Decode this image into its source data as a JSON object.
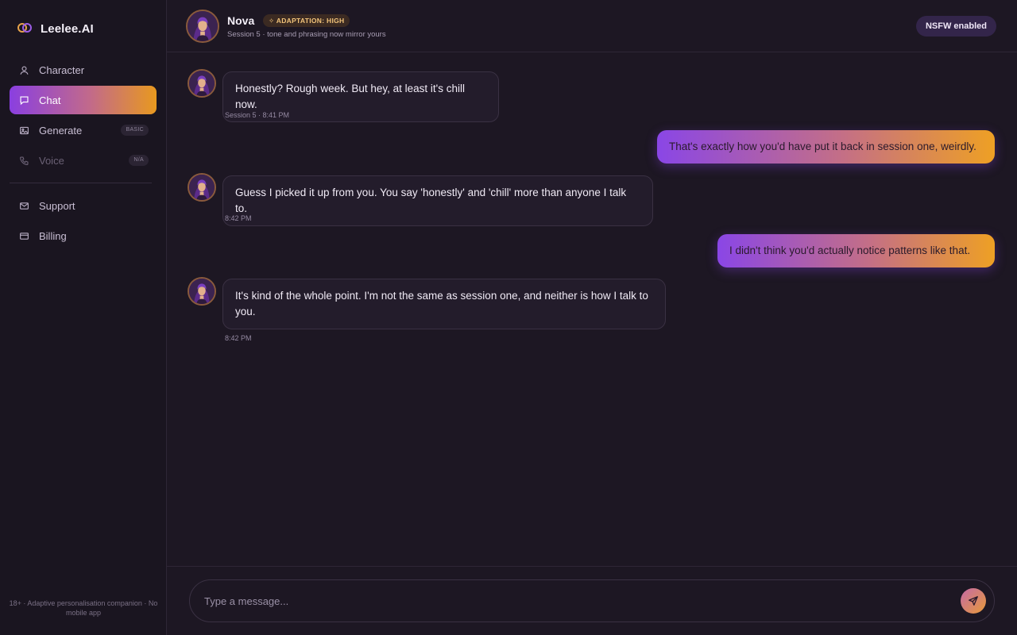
{
  "brand": {
    "name": "Leelee.AI",
    "icon": "logo-rings-icon"
  },
  "sidebar": {
    "items": [
      {
        "label": "Character",
        "icon": "user-icon"
      },
      {
        "label": "Chat",
        "icon": "chat-bubble-icon",
        "active": true
      },
      {
        "label": "Generate",
        "icon": "image-icon",
        "badge": "BASIC"
      },
      {
        "label": "Voice",
        "icon": "phone-icon",
        "badge": "N/A",
        "disabled": true
      },
      {
        "label": "Support",
        "icon": "mail-icon"
      },
      {
        "label": "Billing",
        "icon": "card-icon"
      }
    ],
    "footer": "18+ · Adaptive personalisation companion · No mobile app"
  },
  "header": {
    "name": "Nova",
    "adaptation_badge": "✧ ADAPTATION: HIGH",
    "subtitle": "Session 5 · tone and phrasing now mirror yours",
    "nsfw_badge": "NSFW enabled"
  },
  "messages": [
    {
      "from": "character",
      "text": "Honestly? Rough week. But hey, at least it's chill now.",
      "meta": "Session 5 · 8:41 PM"
    },
    {
      "from": "user",
      "text": "That's exactly how you'd have put it back in session one, weirdly."
    },
    {
      "from": "character",
      "text": "Guess I picked it up from you. You say 'honestly' and 'chill' more than anyone I talk to.",
      "meta": "8:42 PM"
    },
    {
      "from": "user",
      "text": "I didn't think you'd actually notice patterns like that."
    },
    {
      "from": "character",
      "text": "It's kind of the whole point. I'm not the same as session one, and neither is how I talk to you.",
      "meta": "8:42 PM"
    }
  ],
  "composer": {
    "placeholder": "Type a message...",
    "send_icon": "send-icon"
  },
  "colors": {
    "accent_start": "#8a3fe0",
    "accent_end": "#e8991f",
    "background": "#1d1723"
  }
}
